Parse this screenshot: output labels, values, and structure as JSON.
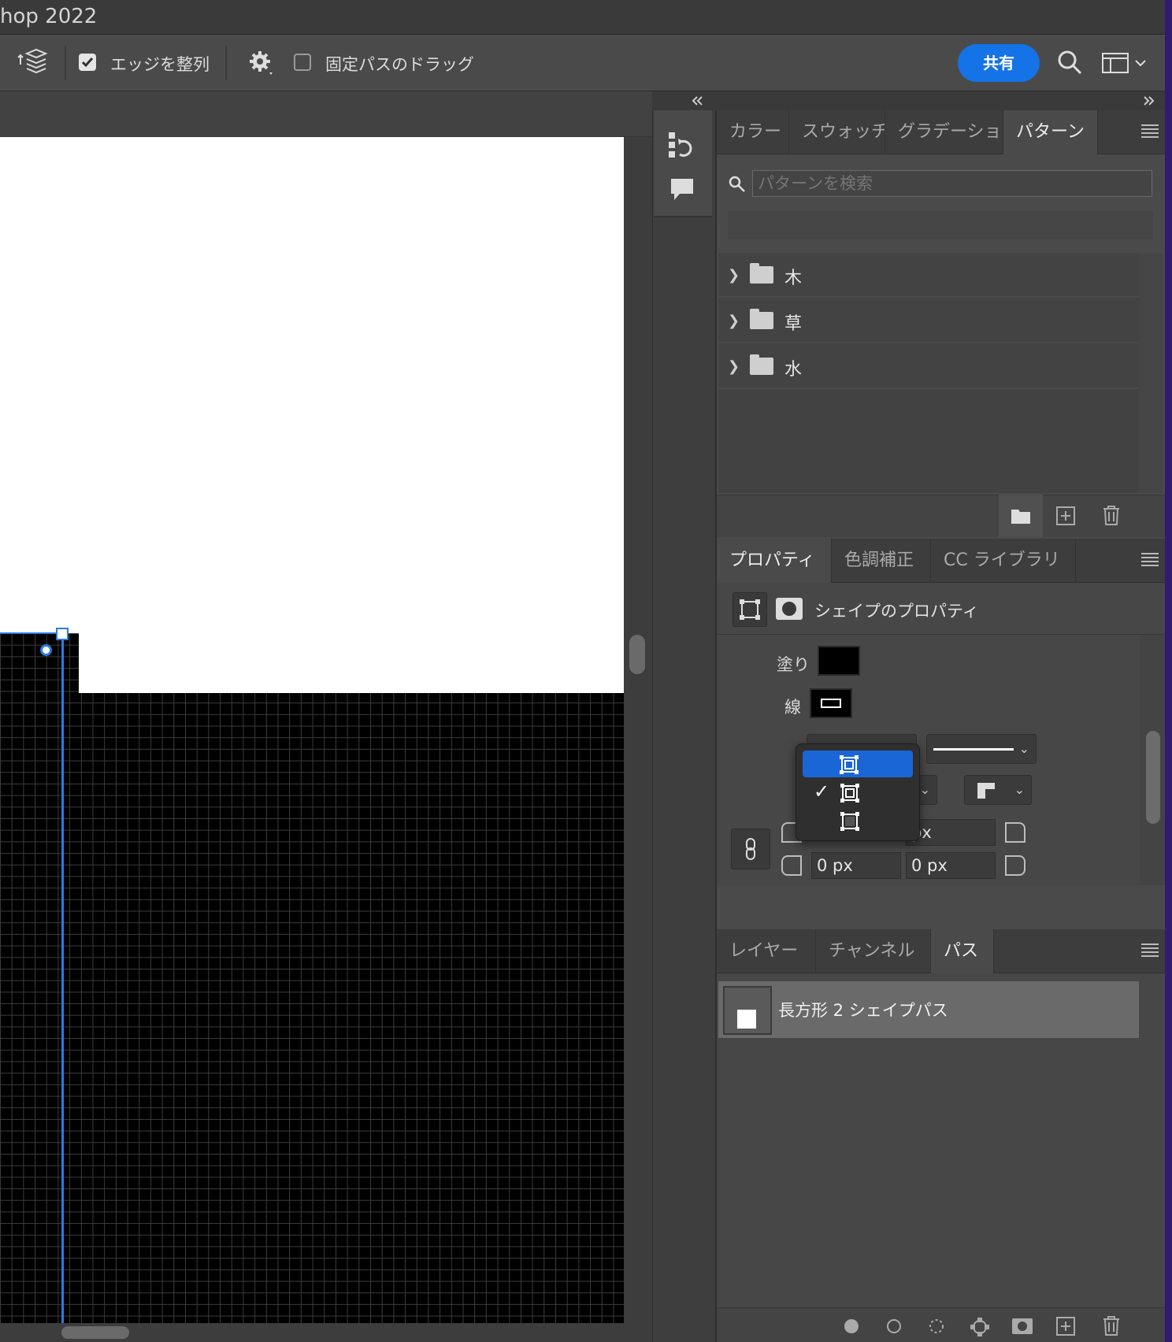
{
  "window": {
    "title": "hop 2022"
  },
  "options_bar": {
    "align_edges": {
      "label": "エッジを整列",
      "checked": true
    },
    "constrain_path_dragging": {
      "label": "固定パスのドラッグ",
      "checked": false
    },
    "share_label": "共有"
  },
  "swatch_panel": {
    "tabs": [
      {
        "label": "カラー",
        "active": false
      },
      {
        "label": "スウォッチ",
        "active": false
      },
      {
        "label": "グラデーショ",
        "active": false
      },
      {
        "label": "パターン",
        "active": true
      }
    ],
    "search_placeholder": "パターンを検索",
    "folders": [
      {
        "name": "木"
      },
      {
        "name": "草"
      },
      {
        "name": "水"
      }
    ]
  },
  "properties_panel": {
    "tabs": [
      {
        "label": "プロパティ",
        "active": true
      },
      {
        "label": "色調補正",
        "active": false
      },
      {
        "label": "CC ライブラリ",
        "active": false
      }
    ],
    "title": "シェイプのプロパティ",
    "fill_label": "塗り",
    "stroke_label": "線",
    "fill_color": "#000000",
    "corner_values": {
      "top_right": "px",
      "bottom_left": "0 px",
      "bottom_right": "0 px"
    },
    "stroke_align_menu": {
      "options": [
        "inside",
        "center",
        "outside"
      ],
      "highlighted_index": 0,
      "checked_index": 1,
      "check_glyph": "✓"
    }
  },
  "layers_panel": {
    "tabs": [
      {
        "label": "レイヤー",
        "active": false
      },
      {
        "label": "チャンネル",
        "active": false
      },
      {
        "label": "パス",
        "active": true
      }
    ],
    "paths": [
      {
        "name": "長方形 2 シェイプパス"
      }
    ]
  },
  "colors": {
    "accent": "#1473e6",
    "selection": "#1a66d6",
    "guide": "#2d7be0"
  }
}
